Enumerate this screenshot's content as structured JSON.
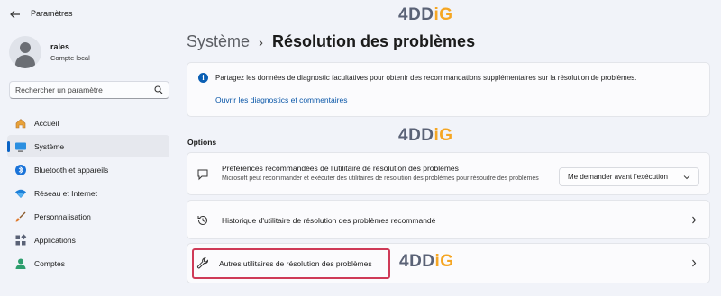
{
  "app": {
    "title": "Paramètres"
  },
  "profile": {
    "name": "rales",
    "account_type": "Compte local"
  },
  "search": {
    "placeholder": "Rechercher un paramètre"
  },
  "nav": {
    "items": [
      {
        "label": "Accueil",
        "icon": "home-icon",
        "active": false
      },
      {
        "label": "Système",
        "icon": "monitor-icon",
        "active": true
      },
      {
        "label": "Bluetooth et appareils",
        "icon": "bluetooth-icon",
        "active": false
      },
      {
        "label": "Réseau et Internet",
        "icon": "wifi-icon",
        "active": false
      },
      {
        "label": "Personnalisation",
        "icon": "brush-icon",
        "active": false
      },
      {
        "label": "Applications",
        "icon": "apps-icon",
        "active": false
      },
      {
        "label": "Comptes",
        "icon": "user-icon",
        "active": false
      }
    ]
  },
  "breadcrumb": {
    "parent": "Système",
    "separator": "›",
    "current": "Résolution des problèmes"
  },
  "info": {
    "text": "Partagez les données de diagnostic facultatives pour obtenir des recommandations supplémentaires sur la résolution de problèmes.",
    "link": "Ouvrir les diagnostics et commentaires"
  },
  "options": {
    "section_label": "Options",
    "preferences": {
      "title": "Préférences recommandées de l'utilitaire de résolution des problèmes",
      "description": "Microsoft peut recommander et exécuter des utilitaires de résolution des problèmes pour résoudre des problèmes",
      "dropdown_value": "Me demander avant l'exécution"
    },
    "history": {
      "title": "Historique d'utilitaire de résolution des problèmes recommandé"
    },
    "other": {
      "title": "Autres utilitaires de résolution des problèmes"
    }
  },
  "watermark": {
    "part1": "4D",
    "part2": "D",
    "part3": "iG"
  },
  "colors": {
    "accent": "#0a63c5",
    "highlight": "#cf3a57",
    "link": "#0a57a8",
    "watermark_orange": "#f5a623"
  }
}
